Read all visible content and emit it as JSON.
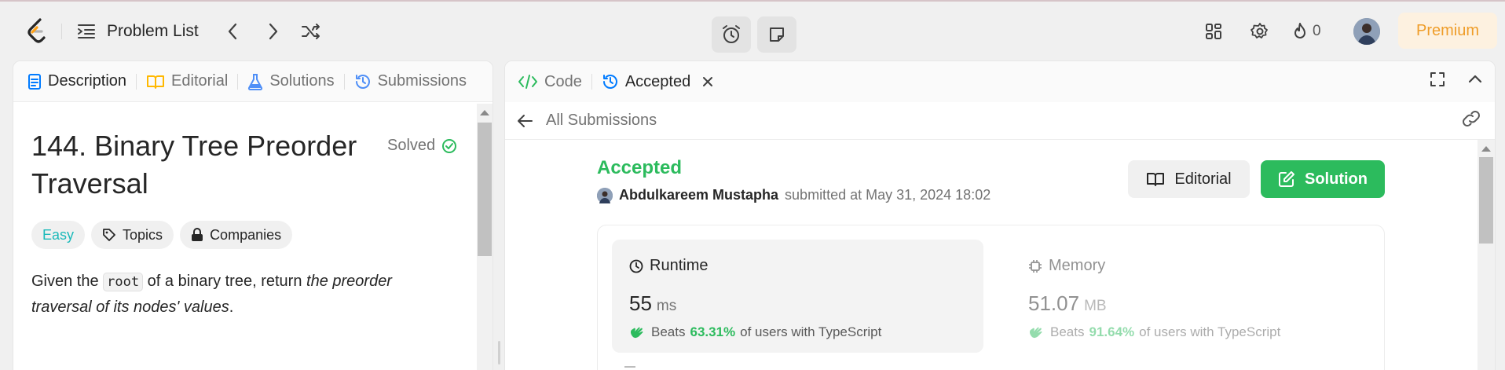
{
  "topbar": {
    "problem_list_label": "Problem List",
    "streak_count": "0",
    "premium_label": "Premium",
    "icons": [
      "leetcode-logo",
      "list-icon",
      "chevron-left-icon",
      "chevron-right-icon",
      "shuffle-icon",
      "timer-icon",
      "note-icon",
      "grid-icon",
      "gear-icon",
      "fire-icon",
      "avatar"
    ]
  },
  "left_tabs": [
    {
      "label": "Description",
      "icon": "document-icon"
    },
    {
      "label": "Editorial",
      "icon": "book-icon"
    },
    {
      "label": "Solutions",
      "icon": "flask-icon"
    },
    {
      "label": "Submissions",
      "icon": "history-icon"
    }
  ],
  "problem": {
    "title": "144. Binary Tree Preorder Traversal",
    "status": "Solved",
    "difficulty": "Easy",
    "topics_label": "Topics",
    "companies_label": "Companies",
    "desc_before": "Given the ",
    "desc_code": "root",
    "desc_mid": " of a binary tree, return ",
    "desc_italic": "the preorder traversal of its nodes' values",
    "desc_end": "."
  },
  "right_tabs": [
    {
      "label": "Code",
      "icon": "code-icon"
    },
    {
      "label": "Accepted",
      "icon": "history-icon"
    }
  ],
  "submission": {
    "back_label": "All Submissions",
    "status": "Accepted",
    "author": "Abdulkareem Mustapha",
    "submitted_text": "submitted at May 31, 2024 18:02",
    "editorial_button": "Editorial",
    "solution_button": "Solution",
    "runtime": {
      "label": "Runtime",
      "value": "55",
      "unit": "ms",
      "beats_label": "Beats",
      "beats_pct": "63.31%",
      "beats_suffix": "of users with TypeScript"
    },
    "memory": {
      "label": "Memory",
      "value": "51.07",
      "unit": "MB",
      "beats_label": "Beats",
      "beats_pct": "91.64%",
      "beats_suffix": "of users with TypeScript"
    }
  },
  "colors": {
    "accent_green": "#2cbb5d",
    "easy_teal": "#1cbaba",
    "premium_orange": "#ef9d29",
    "active_blue": "#007bff"
  }
}
